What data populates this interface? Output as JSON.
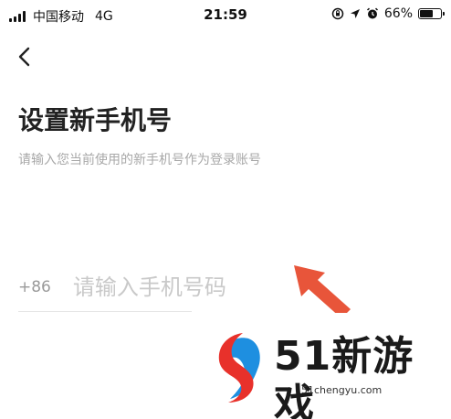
{
  "status_bar": {
    "carrier": "中国移动",
    "network": "4G",
    "time": "21:59",
    "battery_text": "66%",
    "battery_level": 0.66
  },
  "header": {
    "back_icon": "chevron-left-icon"
  },
  "main": {
    "title": "设置新手机号",
    "subtitle": "请输入您当前使用的新手机号作为登录账号",
    "phone": {
      "country_code": "+86",
      "placeholder": "请输入手机号码",
      "value": ""
    }
  },
  "annotation": {
    "arrow_color": "#e8553a"
  },
  "watermark": {
    "name": "51新游戏",
    "url": "51chengyu.com",
    "colors": {
      "red": "#e8312b",
      "blue": "#1e8fe0"
    }
  }
}
